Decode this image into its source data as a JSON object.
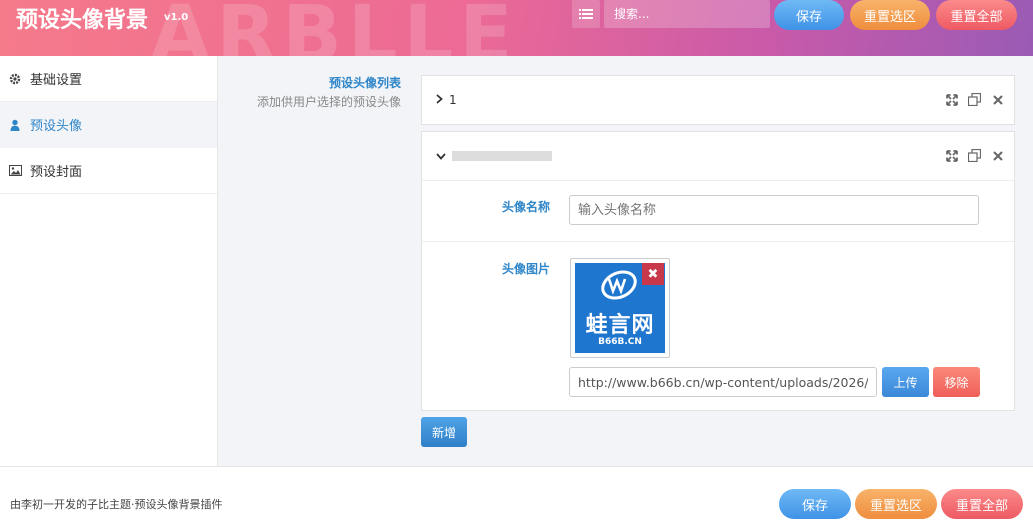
{
  "header": {
    "title": "预设头像背景",
    "version": "v1.0",
    "watermark": "ARBLLE",
    "search_placeholder": "搜索...",
    "save_label": "保存",
    "reset_section_label": "重置选区",
    "reset_all_label": "重置全部"
  },
  "sidebar": {
    "items": [
      {
        "label": "基础设置",
        "icon": "gear-icon",
        "active": false
      },
      {
        "label": "预设头像",
        "icon": "user-icon",
        "active": true
      },
      {
        "label": "预设封面",
        "icon": "image-icon",
        "active": false
      }
    ]
  },
  "section": {
    "title": "预设头像列表",
    "description": "添加供用户选择的预设头像"
  },
  "panels": [
    {
      "label": "1",
      "collapsed": true
    },
    {
      "label": "",
      "collapsed": false
    }
  ],
  "form": {
    "name_label": "头像名称",
    "name_placeholder": "输入头像名称",
    "image_label": "头像图片",
    "image_logo_text": "蛙言网",
    "image_logo_sub": "B66B.CN",
    "image_url": "http://www.b66b.cn/wp-content/uploads/2026/",
    "upload_label": "上传",
    "remove_label": "移除"
  },
  "add_label": "新增",
  "footer": {
    "credit": "由李初一开发的子比主题·预设头像背景插件",
    "save_label": "保存",
    "reset_section_label": "重置选区",
    "reset_all_label": "重置全部"
  },
  "colors": {
    "accent": "#2f86c9",
    "save": "#4a9ae8",
    "reset_section": "#f09a48",
    "reset_all": "#f06a70",
    "remove": "#c8374a"
  }
}
